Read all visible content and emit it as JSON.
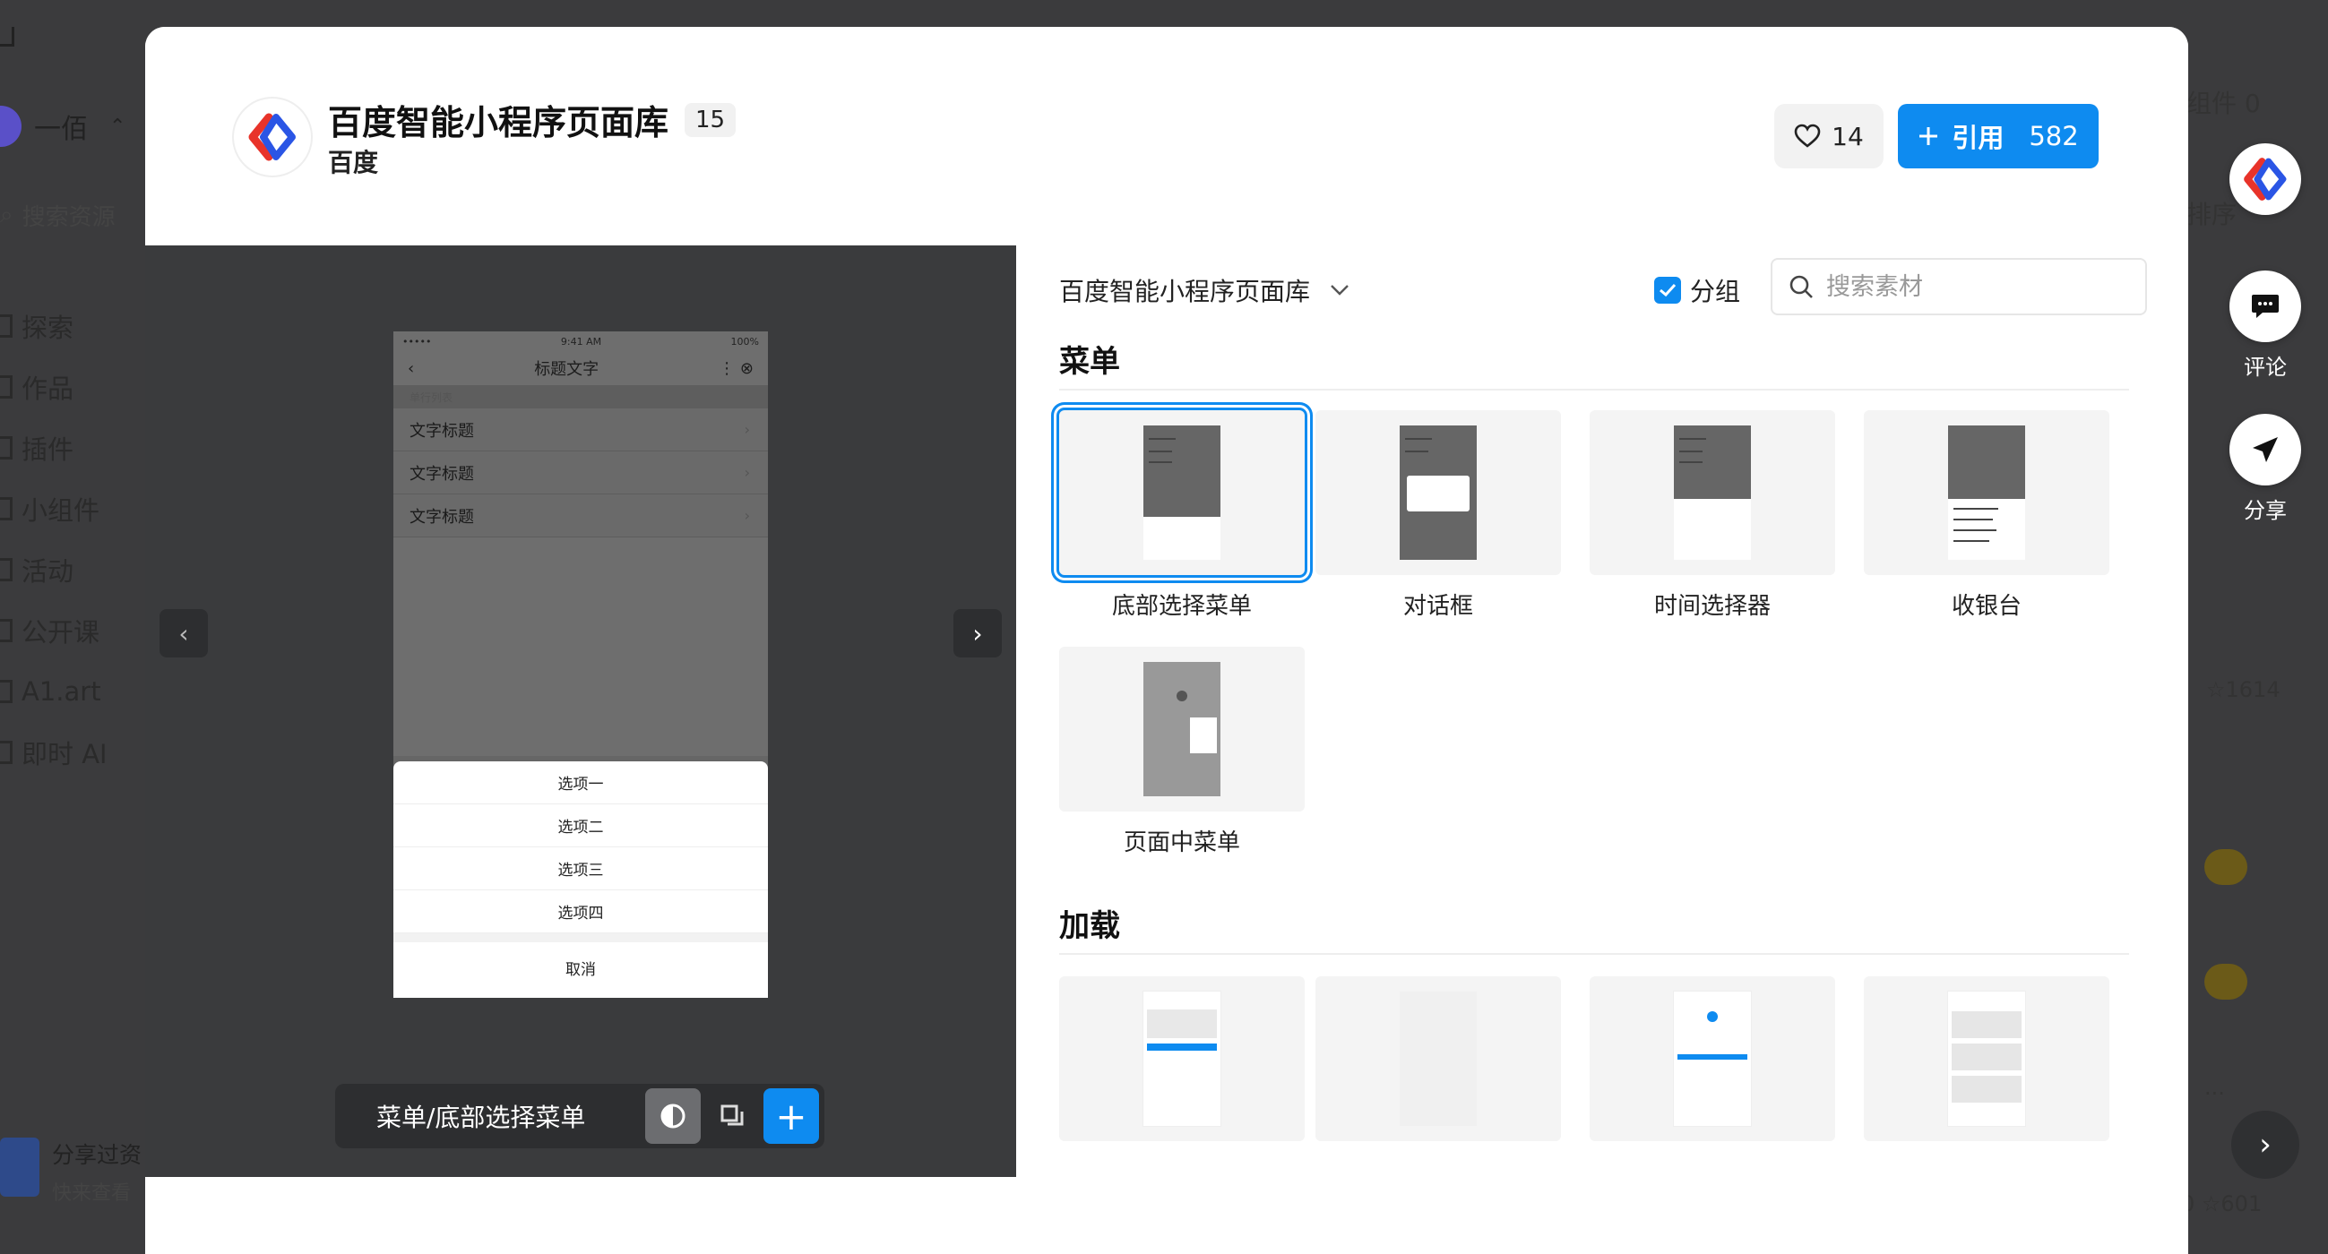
{
  "background": {
    "user_name": "一佰",
    "search_placeholder": "搜索资源",
    "nav": [
      "探索",
      "作品",
      "插件",
      "小组件",
      "活动",
      "公开课",
      "A1.art",
      "即时 AI"
    ],
    "share_title": "分享过资",
    "share_sub": "快来查看",
    "right_texts": {
      "component": "组件 0",
      "sort": "排序",
      "star1": "☆1614",
      "star2": "0 ☆601",
      "dots": "..."
    }
  },
  "header": {
    "title": "百度智能小程序页面库",
    "count_badge": "15",
    "author": "百度",
    "like_count": "14",
    "cite_label": "引用",
    "cite_count": "582"
  },
  "preview": {
    "status_left": "•••••",
    "status_time": "9:41 AM",
    "status_battery": "100%",
    "nav_title": "标题文字",
    "section_label": "单行列表",
    "rows": [
      "文字标题",
      "文字标题",
      "文字标题"
    ],
    "options": [
      "选项一",
      "选项二",
      "选项三",
      "选项四"
    ],
    "cancel": "取消",
    "path": "菜单/底部选择菜单"
  },
  "panel": {
    "library": "百度智能小程序页面库",
    "group_label": "分组",
    "group_checked": true,
    "search_placeholder": "搜索素材",
    "sections": [
      {
        "title": "菜单",
        "items": [
          "底部选择菜单",
          "对话框",
          "时间选择器",
          "收银台",
          "页面中菜单"
        ]
      },
      {
        "title": "加载",
        "items": [
          "",
          "",
          "",
          ""
        ]
      }
    ]
  },
  "fab": {
    "comment": "评论",
    "share": "分享"
  },
  "colors": {
    "accent": "#0e8bf0",
    "logo_red": "#e8332a",
    "logo_blue": "#2a55e5"
  }
}
